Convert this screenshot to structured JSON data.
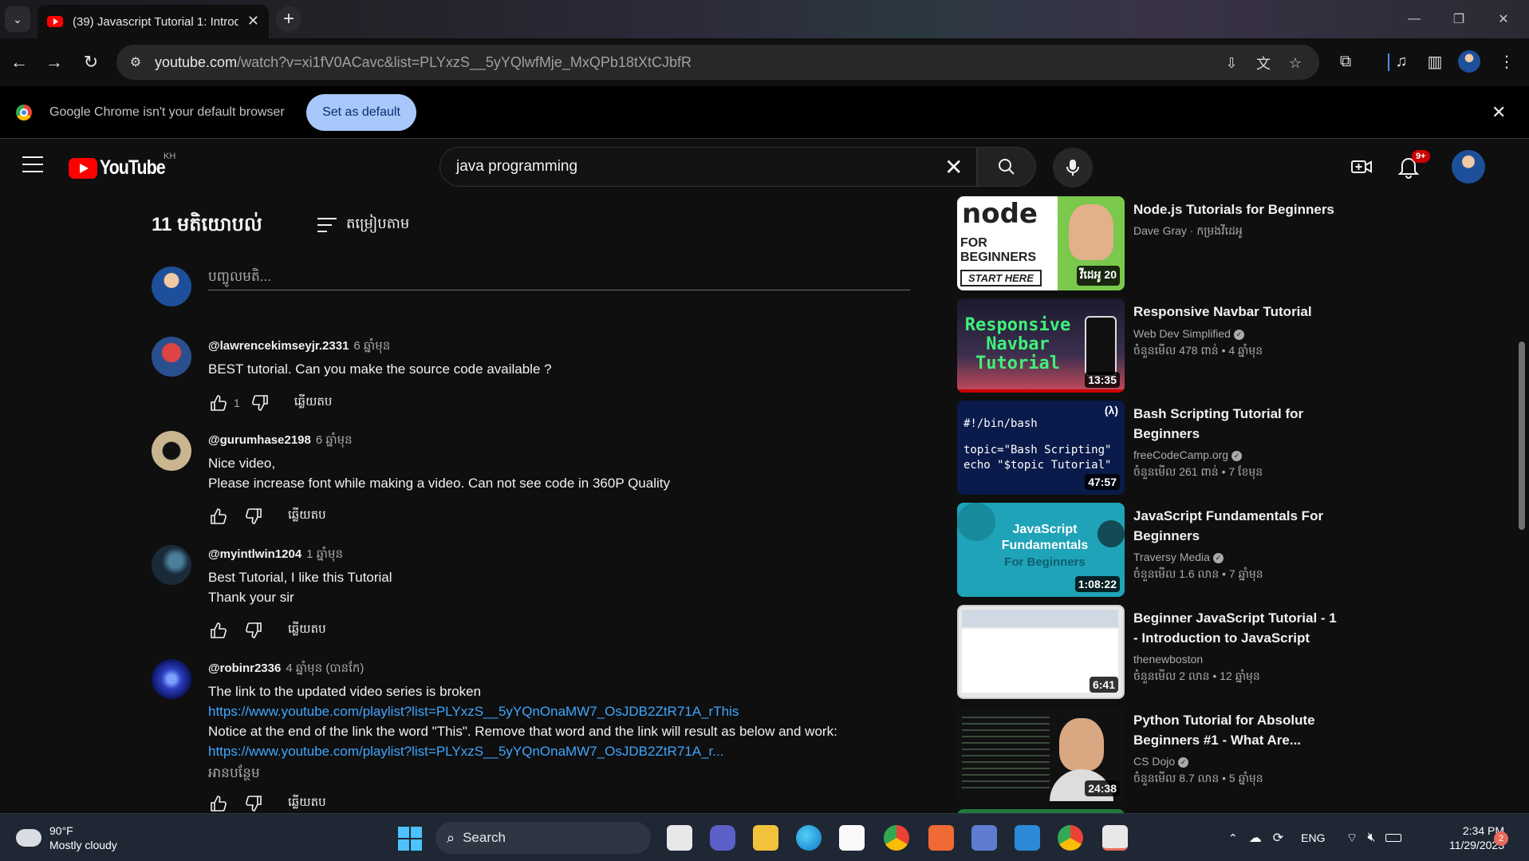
{
  "browser": {
    "tab_title": "(39) Javascript Tutorial 1: Introd",
    "url_domain": "youtube.com",
    "url_path": "/watch?v=xi1fV0ACavc&list=PLYxzS__5yYQlwfMje_MxQPb18tXtCJbfR"
  },
  "infobar": {
    "message": "Google Chrome isn't your default browser",
    "button": "Set as default"
  },
  "youtube": {
    "logo_text": "YouTube",
    "country": "KH",
    "search_value": "java programming",
    "notification_badge": "9+"
  },
  "comments": {
    "count_label": "11 មតិយោបល់",
    "sort_label": "តម្រៀបតាម",
    "add_placeholder": "បញ្ចូលមតិ...",
    "reply_label": "ឆ្លើយតប",
    "items": [
      {
        "handle": "@lawrencekimseyjr.2331",
        "time": "6 ឆ្នាំមុន",
        "lines": [
          "BEST tutorial. Can you make the source code available ?"
        ],
        "likes": "1"
      },
      {
        "handle": "@gurumhase2198",
        "time": "6 ឆ្នាំមុន",
        "lines": [
          "Nice video,",
          "Please increase font while making a video. Can not see code in 360P Quality"
        ],
        "likes": ""
      },
      {
        "handle": "@myintlwin1204",
        "time": "1 ឆ្នាំមុន",
        "lines": [
          "Best Tutorial, I like this Tutorial",
          "Thank your sir"
        ],
        "likes": ""
      },
      {
        "handle": "@robinr2336",
        "time": "4 ឆ្នាំមុន (បានកែ)",
        "lines": [
          "The link to the updated video series is broken",
          "https://www.youtube.com/playlist?list=PLYxzS__5yYQnOnaMW7_OsJDB2ZtR71A_rThis",
          "Notice at the end of the link the word \"This\".  Remove that word and the link will result as below and work:",
          "https://www.youtube.com/playlist?list=PLYxzS__5yYQnOnaMW7_OsJDB2ZtR71A_r..."
        ],
        "read_more": "អានបន្ថែម",
        "likes": ""
      }
    ]
  },
  "recommendations": [
    {
      "title": "Node.js Tutorials for Beginners",
      "channel": "Dave Gray · កម្រងវីដេអូ",
      "meta": "",
      "duration": "វីដេអូ 20",
      "thumb_text": "FOR BEGINNERS",
      "thumb_sub": "START HERE"
    },
    {
      "title": "Responsive Navbar Tutorial",
      "channel": "Web Dev Simplified",
      "meta": "ចំនួនមើល 478 ពាន់  • 4 ឆ្នាំមុន",
      "duration": "13:35",
      "thumb_text": "Responsive Navbar Tutorial"
    },
    {
      "title": "Bash Scripting Tutorial for Beginners",
      "channel": "freeCodeCamp.org",
      "meta": "ចំនួនមើល 261 ពាន់  • 7 ខែមុន",
      "duration": "47:57",
      "thumb_lines": [
        "#!/bin/bash",
        "topic=\"Bash Scripting\"",
        "echo \"$topic Tutorial\""
      ]
    },
    {
      "title": "JavaScript Fundamentals For Beginners",
      "channel": "Traversy Media",
      "meta": "ចំនួនមើល 1.6 លាន  • 7 ឆ្នាំមុន",
      "duration": "1:08:22",
      "thumb_text": "JavaScript Fundamentals",
      "thumb_sub": "For Beginners"
    },
    {
      "title": "Beginner JavaScript Tutorial - 1 - Introduction to JavaScript",
      "channel": "thenewboston",
      "meta": "ចំនួនមើល 2 លាន  • 12 ឆ្នាំមុន",
      "duration": "6:41"
    },
    {
      "title": "Python Tutorial for Absolute Beginners #1 - What Are...",
      "channel": "CS Dojo",
      "meta": "ចំនួនមើល 8.7 លាន  • 5 ឆ្នាំមុន",
      "duration": "24:38"
    }
  ],
  "taskbar": {
    "temp": "90°F",
    "condition": "Mostly cloudy",
    "search_label": "Search",
    "lang": "ENG",
    "time": "2:34 PM",
    "date": "11/29/2023",
    "notif_count": "2"
  }
}
